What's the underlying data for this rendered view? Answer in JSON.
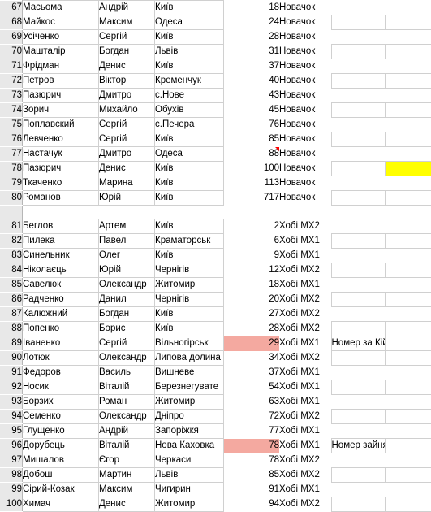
{
  "app": {
    "type": "spreadsheet",
    "highlight_pink": "#f4a9a0",
    "highlight_yellow": "#ffff00",
    "comment_marker_color": "#ff0000",
    "row_header_bg": "#e8e8e8",
    "gridline_color": "#d0d0d0"
  },
  "columns": [
    {
      "key": "surname",
      "name": "surname-column"
    },
    {
      "key": "first",
      "name": "first-name-column"
    },
    {
      "key": "city",
      "name": "city-column"
    },
    {
      "key": "num",
      "name": "number-column"
    },
    {
      "key": "cat",
      "name": "category-column"
    },
    {
      "key": "note",
      "name": "note-column"
    },
    {
      "key": "extra",
      "name": "extra-column"
    }
  ],
  "rows": [
    {
      "n": "67",
      "surname": "Масьома",
      "first": "Андрій",
      "city": "Київ",
      "num": "18",
      "cat": "Новачок",
      "note": "",
      "extra": ""
    },
    {
      "n": "68",
      "surname": "Майкос",
      "first": "Максим",
      "city": "Одеса",
      "num": "24",
      "cat": "Новачок",
      "note": "",
      "extra": ""
    },
    {
      "n": "69",
      "surname": "Усіченко",
      "first": "Сергій",
      "city": "Київ",
      "num": "28",
      "cat": "Новачок",
      "note": "",
      "extra": ""
    },
    {
      "n": "70",
      "surname": "Машталір",
      "first": "Богдан",
      "city": "Львів",
      "num": "31",
      "cat": "Новачок",
      "note": "",
      "extra": ""
    },
    {
      "n": "71",
      "surname": "Фрідман",
      "first": "Денис",
      "city": "Київ",
      "num": "37",
      "cat": "Новачок",
      "note": "",
      "extra": ""
    },
    {
      "n": "72",
      "surname": "Петров",
      "first": "Віктор",
      "city": "Кременчук",
      "num": "40",
      "cat": "Новачок",
      "note": "",
      "extra": ""
    },
    {
      "n": "73",
      "surname": "Пазюрич",
      "first": "Дмитро",
      "city": "с.Нове",
      "num": "43",
      "cat": "Новачок",
      "note": "",
      "extra": ""
    },
    {
      "n": "74",
      "surname": "Зорич",
      "first": "Михайло",
      "city": "Обухів",
      "num": "45",
      "cat": "Новачок",
      "note": "",
      "extra": ""
    },
    {
      "n": "75",
      "surname": "Поплавский",
      "first": "Сергій",
      "city": "с.Печера",
      "num": "76",
      "cat": "Новачок",
      "note": "",
      "extra": ""
    },
    {
      "n": "76",
      "surname": "Левченко",
      "first": "Сергій",
      "city": "Київ",
      "num": "85",
      "cat": "Новачок",
      "note": "",
      "extra": ""
    },
    {
      "n": "77",
      "surname": "Настачук",
      "first": "Дмитро",
      "city": "Одеса",
      "num": "88",
      "cat": "Новачок",
      "note": "",
      "extra": ""
    },
    {
      "n": "78",
      "surname": "Пазюрич",
      "first": "Денис",
      "city": "Київ",
      "num": "100",
      "cat": "Новачок",
      "note": "",
      "extra": ""
    },
    {
      "n": "79",
      "surname": "Ткаченко",
      "first": "Марина",
      "city": "Київ",
      "num": "113",
      "cat": "Новачок",
      "note": "",
      "extra": ""
    },
    {
      "n": "80",
      "surname": "Романов",
      "first": "Юрій",
      "city": "Київ",
      "num": "717",
      "cat": "Новачок",
      "note": "",
      "extra": ""
    },
    {
      "n": "81",
      "surname": "Беглов",
      "first": "Артем",
      "city": "Київ",
      "num": "2",
      "cat": "Хобі МХ2",
      "note": "",
      "extra": ""
    },
    {
      "n": "82",
      "surname": "Пилека",
      "first": "Павел",
      "city": "Краматорськ",
      "num": "6",
      "cat": "Хобі МХ1",
      "note": "",
      "extra": ""
    },
    {
      "n": "83",
      "surname": "Синельник",
      "first": "Олег",
      "city": "Київ",
      "num": "9",
      "cat": "Хобі МХ1",
      "note": "",
      "extra": ""
    },
    {
      "n": "84",
      "surname": "Ніколаєць",
      "first": "Юрій",
      "city": "Чернігів",
      "num": "12",
      "cat": "Хобі МХ2",
      "note": "",
      "extra": ""
    },
    {
      "n": "85",
      "surname": "Савелюк",
      "first": "Олександр",
      "city": "Житомир",
      "num": "18",
      "cat": "Хобі МХ1",
      "note": "",
      "extra": ""
    },
    {
      "n": "86",
      "surname": "Радченко",
      "first": "Данил",
      "city": "Чернігів",
      "num": "20",
      "cat": "Хобі МХ2",
      "note": "",
      "extra": ""
    },
    {
      "n": "87",
      "surname": "Калюжний",
      "first": "Богдан",
      "city": "Київ",
      "num": "27",
      "cat": "Хобі МХ2",
      "note": "",
      "extra": ""
    },
    {
      "n": "88",
      "surname": "Попенко",
      "first": "Борис",
      "city": "Київ",
      "num": "28",
      "cat": "Хобі МХ2",
      "note": "",
      "extra": ""
    },
    {
      "n": "89",
      "surname": "Іваненко",
      "first": "Сергій",
      "city": "Вільногірськ",
      "num": "29",
      "cat": "Хобі МХ1",
      "note": "Номер за Кійко А.",
      "extra": ""
    },
    {
      "n": "90",
      "surname": "Лотюк",
      "first": "Олександр",
      "city": "Липова долина",
      "num": "34",
      "cat": "Хобі МХ2",
      "note": "",
      "extra": ""
    },
    {
      "n": "91",
      "surname": "Федоров",
      "first": "Василь",
      "city": "Вишневе",
      "num": "37",
      "cat": "Хобі МХ1",
      "note": "",
      "extra": ""
    },
    {
      "n": "92",
      "surname": "Носик",
      "first": "Віталій",
      "city": "Березнегувате",
      "num": "54",
      "cat": "Хобі МХ1",
      "note": "",
      "extra": ""
    },
    {
      "n": "93",
      "surname": "Борзих",
      "first": "Роман",
      "city": "Житомир",
      "num": "63",
      "cat": "Хобі МХ1",
      "note": "",
      "extra": ""
    },
    {
      "n": "94",
      "surname": "Семенко",
      "first": "Олександр",
      "city": "Дніпро",
      "num": "72",
      "cat": "Хобі МХ2",
      "note": "",
      "extra": ""
    },
    {
      "n": "95",
      "surname": "Глущенко",
      "first": "Андрій",
      "city": "Запоріжкя",
      "num": "77",
      "cat": "Хобі МХ1",
      "note": "",
      "extra": ""
    },
    {
      "n": "96",
      "surname": "Дорубець",
      "first": "Віталій",
      "city": "Нова Каховка",
      "num": "78",
      "cat": "Хобі МХ1",
      "note": "Номер зайнятий",
      "extra": ""
    },
    {
      "n": "97",
      "surname": "Мишалов",
      "first": "Єгор",
      "city": "Черкаси",
      "num": "78",
      "cat": "Хобі МХ2",
      "note": "",
      "extra": ""
    },
    {
      "n": "98",
      "surname": "Добош",
      "first": "Мартин",
      "city": "Львів",
      "num": "85",
      "cat": "Хобі МХ2",
      "note": "",
      "extra": ""
    },
    {
      "n": "99",
      "surname": "Сірий-Козак",
      "first": "Максим",
      "city": "Чигирин",
      "num": "91",
      "cat": "Хобі МХ1",
      "note": "",
      "extra": ""
    },
    {
      "n": "100",
      "surname": "Химач",
      "first": "Денис",
      "city": "Житомир",
      "num": "94",
      "cat": "Хобі МХ2",
      "note": "",
      "extra": ""
    }
  ],
  "annotations": {
    "pink_number_rows": [
      "89",
      "96"
    ],
    "yellow_extra_rows": [
      "78"
    ],
    "comment_rows": [
      "77"
    ]
  }
}
